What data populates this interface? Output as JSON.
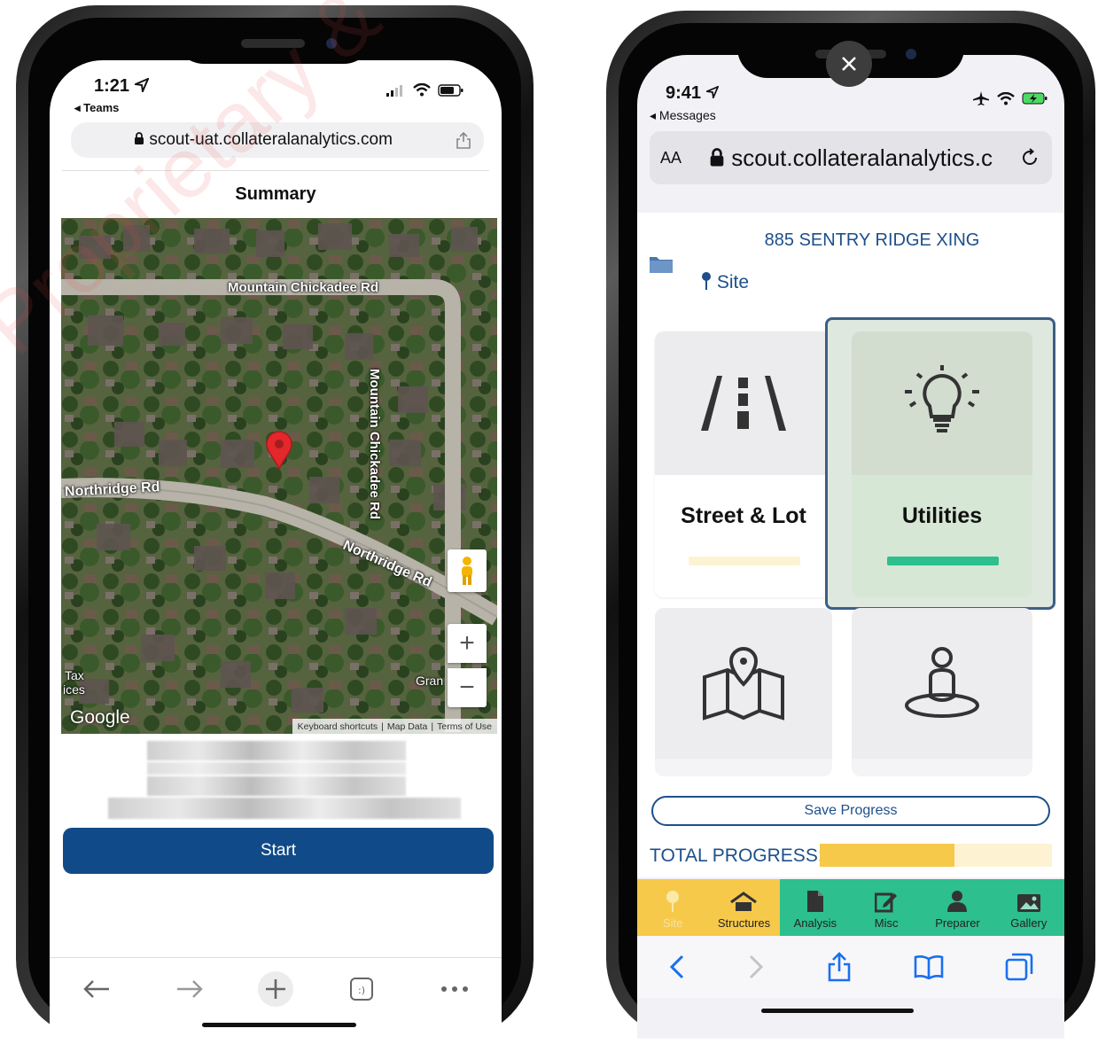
{
  "left_phone": {
    "status": {
      "time": "1:21",
      "back_app": "Teams"
    },
    "url": "scout-uat.collateralanalytics.com",
    "page_title": "Summary",
    "map": {
      "roads": [
        "Mountain Chickadee Rd",
        "Mountain Chickadee Rd",
        "Northridge Rd",
        "Northridge Rd"
      ],
      "edge_labels": [
        "Tax",
        "ices",
        "Gran"
      ],
      "logo": "Google",
      "footer_links": [
        "Keyboard shortcuts",
        "Map Data",
        "Terms of Use"
      ],
      "zoom_in": "+",
      "zoom_out": "−"
    },
    "start_label": "Start"
  },
  "right_phone": {
    "status": {
      "time": "9:41",
      "back_app": "Messages"
    },
    "text_size_label": "AA",
    "url": "scout.collateralanalytics.c",
    "address": "885 SENTRY RIDGE XING",
    "section_label": "Site",
    "tiles": [
      {
        "label": "Street & Lot",
        "icon": "road-icon",
        "progress": 0,
        "selected": false
      },
      {
        "label": "Utilities",
        "icon": "lightbulb-icon",
        "progress": 1.0,
        "selected": true
      },
      {
        "label": "",
        "icon": "map-pin-icon",
        "progress": null,
        "selected": false
      },
      {
        "label": "",
        "icon": "person-location-icon",
        "progress": null,
        "selected": false
      }
    ],
    "save_label": "Save Progress",
    "total_progress_label": "TOTAL PROGRESS:",
    "total_progress": 0.58,
    "tabs": [
      {
        "label": "Site",
        "icon": "pin-icon"
      },
      {
        "label": "Structures",
        "icon": "house-icon"
      },
      {
        "label": "Analysis",
        "icon": "document-icon"
      },
      {
        "label": "Misc",
        "icon": "edit-icon"
      },
      {
        "label": "Preparer",
        "icon": "person-icon"
      },
      {
        "label": "Gallery",
        "icon": "image-icon"
      }
    ],
    "colors": {
      "accent_blue": "#1d4f8a",
      "green": "#2dbf8e",
      "yellow": "#f7c94a",
      "pale_yellow": "#fdf3d2"
    }
  },
  "watermark": "Proprietary & Confidential – Collateral Analytics LLC"
}
